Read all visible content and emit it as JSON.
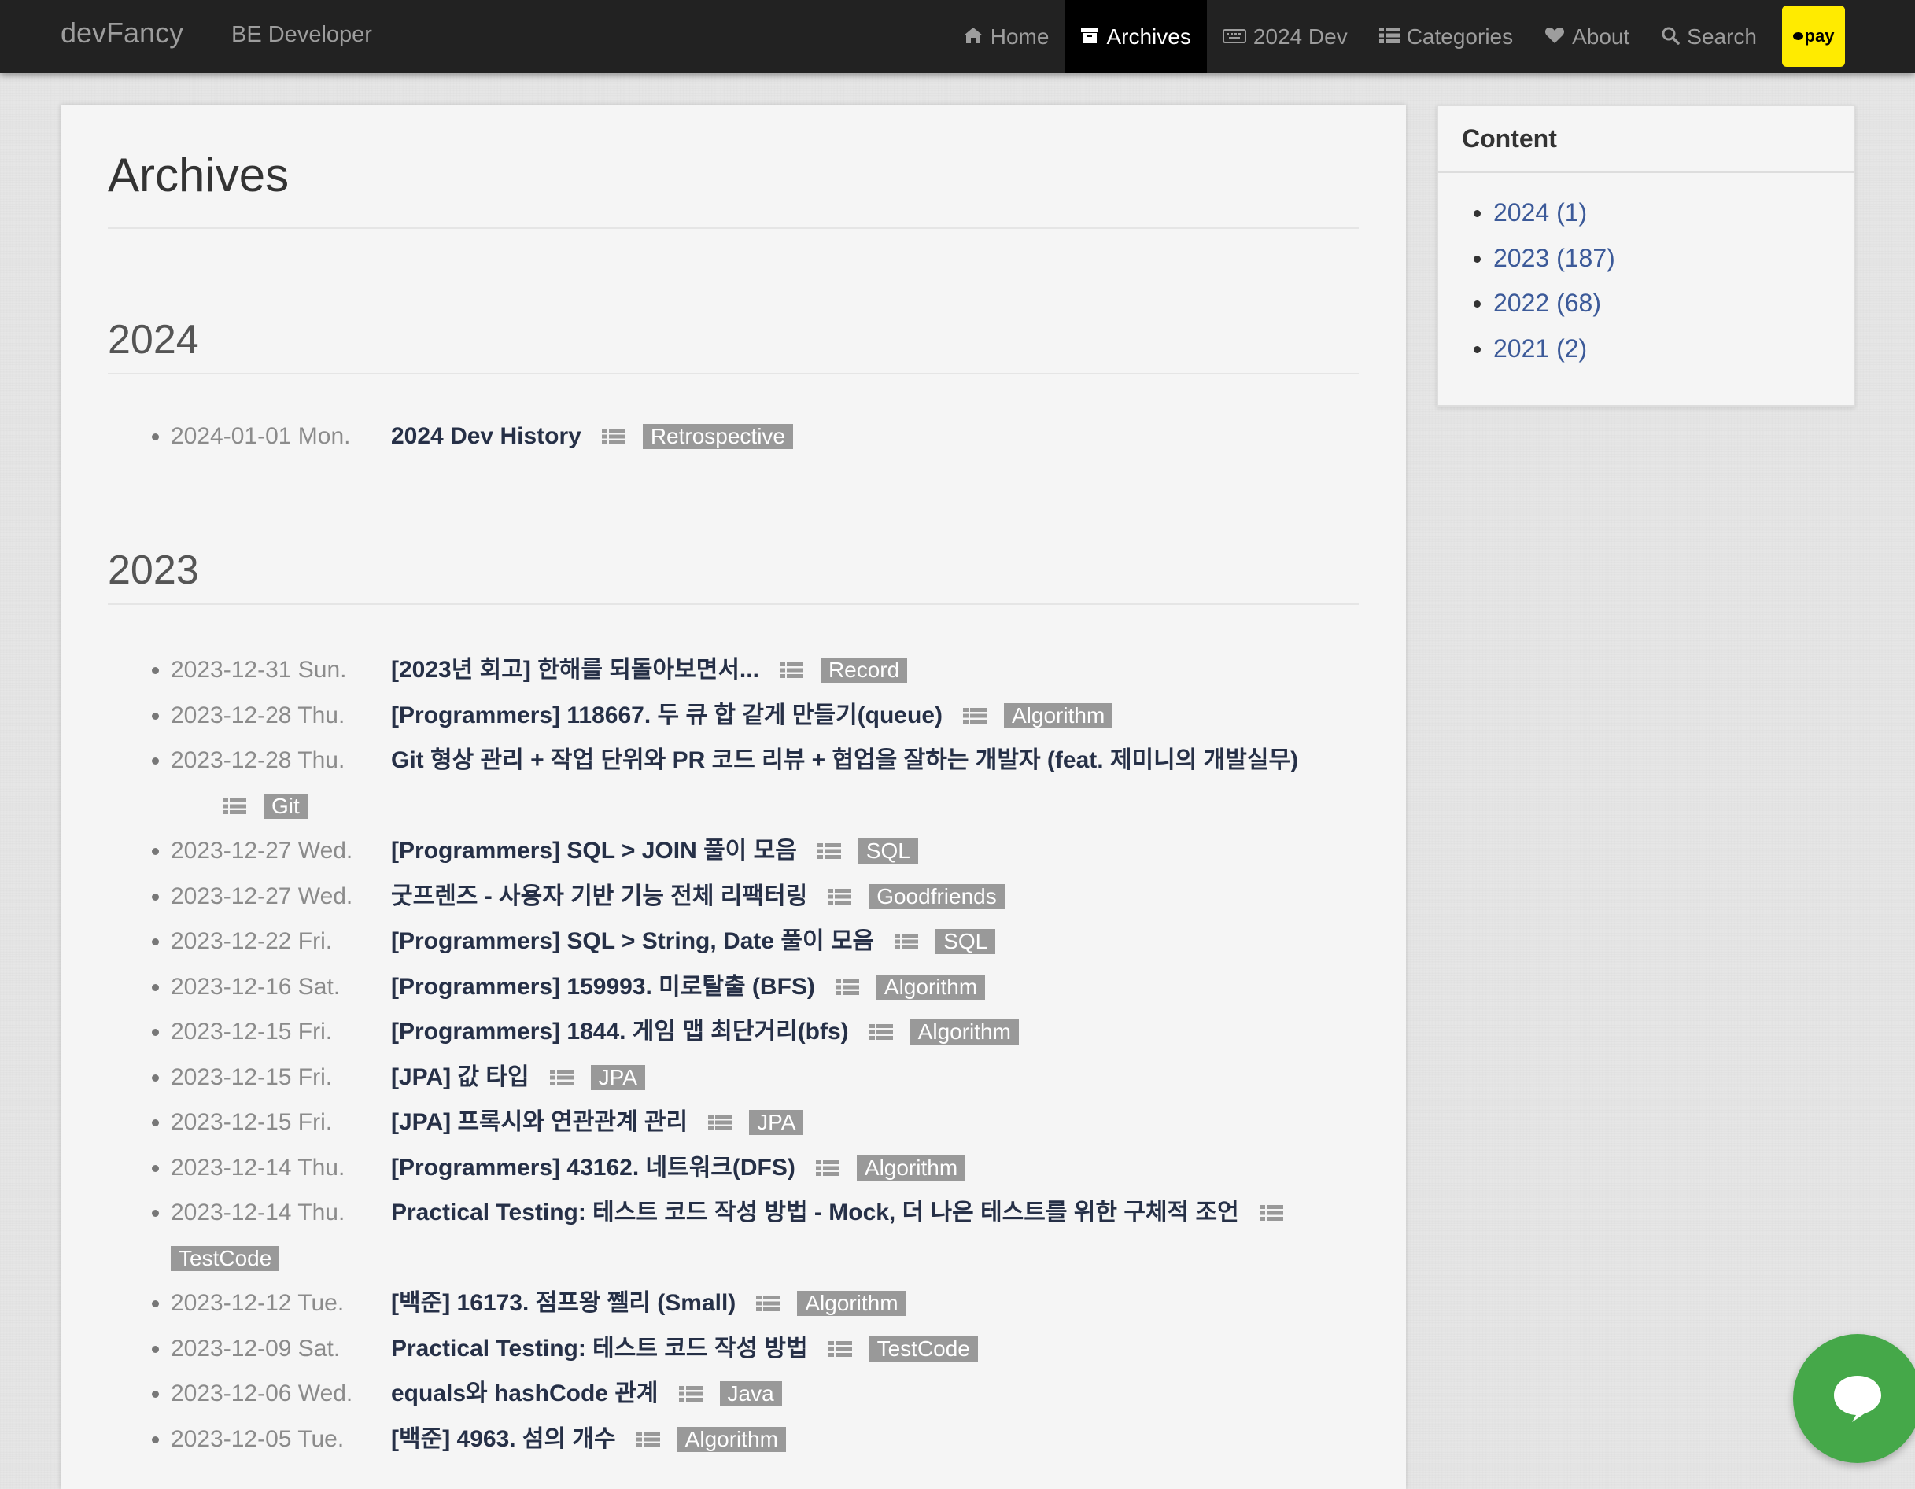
{
  "header": {
    "brand": "devFancy",
    "tagline": "BE Developer",
    "nav": [
      {
        "label": "Home",
        "icon": "home-icon",
        "active": false
      },
      {
        "label": "Archives",
        "icon": "archive-icon",
        "active": true
      },
      {
        "label": "2024 Dev",
        "icon": "keyboard-icon",
        "active": false
      },
      {
        "label": "Categories",
        "icon": "list-icon",
        "active": false
      },
      {
        "label": "About",
        "icon": "heart-icon",
        "active": false
      },
      {
        "label": "Search",
        "icon": "search-icon",
        "active": false
      }
    ],
    "pay_label": "pay"
  },
  "main": {
    "title": "Archives",
    "year_2024": {
      "heading": "2024",
      "posts": [
        {
          "date": "2024-01-01 Mon.",
          "title": "2024 Dev History",
          "tag": "Retrospective"
        }
      ]
    },
    "year_2023": {
      "heading": "2023",
      "posts": [
        {
          "date": "2023-12-31 Sun.",
          "title": "[2023년 회고] 한해를 되돌아보면서...",
          "tag": "Record"
        },
        {
          "date": "2023-12-28 Thu.",
          "title": "[Programmers] 118667. 두 큐 합 같게 만들기(queue)",
          "tag": "Algorithm"
        },
        {
          "date": "2023-12-28 Thu.",
          "title": "Git 형상 관리 + 작업 단위와 PR 코드 리뷰 + 협업을 잘하는 개발자 (feat. 제미니의 개발실무)",
          "tag": "Git"
        },
        {
          "date": "2023-12-27 Wed.",
          "title": "[Programmers] SQL > JOIN 풀이 모음",
          "tag": "SQL"
        },
        {
          "date": "2023-12-27 Wed.",
          "title": "굿프렌즈 - 사용자 기반 기능 전체 리팩터링",
          "tag": "Goodfriends"
        },
        {
          "date": "2023-12-22 Fri.",
          "title": "[Programmers] SQL > String, Date 풀이 모음",
          "tag": "SQL"
        },
        {
          "date": "2023-12-16 Sat.",
          "title": "[Programmers] 159993. 미로탈출 (BFS)",
          "tag": "Algorithm"
        },
        {
          "date": "2023-12-15 Fri.",
          "title": "[Programmers] 1844. 게임 맵 최단거리(bfs)",
          "tag": "Algorithm"
        },
        {
          "date": "2023-12-15 Fri.",
          "title": "[JPA] 값 타입",
          "tag": "JPA"
        },
        {
          "date": "2023-12-15 Fri.",
          "title": "[JPA] 프록시와 연관관계 관리",
          "tag": "JPA"
        },
        {
          "date": "2023-12-14 Thu.",
          "title": "[Programmers] 43162. 네트워크(DFS)",
          "tag": "Algorithm"
        },
        {
          "date": "2023-12-14 Thu.",
          "title": "Practical Testing: 테스트 코드 작성 방법 - Mock, 더 나은 테스트를 위한 구체적 조언",
          "tag": "TestCode"
        },
        {
          "date": "2023-12-12 Tue.",
          "title": "[백준] 16173. 점프왕 쩰리 (Small)",
          "tag": "Algorithm"
        },
        {
          "date": "2023-12-09 Sat.",
          "title": "Practical Testing: 테스트 코드 작성 방법",
          "tag": "TestCode"
        },
        {
          "date": "2023-12-06 Wed.",
          "title": "equals와 hashCode 관계",
          "tag": "Java"
        },
        {
          "date": "2023-12-05 Tue.",
          "title": "[백준] 4963. 섬의 개수",
          "tag": "Algorithm"
        }
      ]
    }
  },
  "sidebar": {
    "title": "Content",
    "items": [
      {
        "label": "2024 (1)"
      },
      {
        "label": "2023 (187)"
      },
      {
        "label": "2022 (68)"
      },
      {
        "label": "2021 (2)"
      }
    ]
  },
  "chat": {
    "icon": "chat-bubble-icon"
  },
  "colors": {
    "navbar": "#222222",
    "nav_active": "#000000",
    "pay_button": "#ffeb00",
    "tag_bg": "#999999",
    "post_title": "#263047",
    "sidebar_link": "#3c5a99",
    "chat_button": "#45a849"
  }
}
